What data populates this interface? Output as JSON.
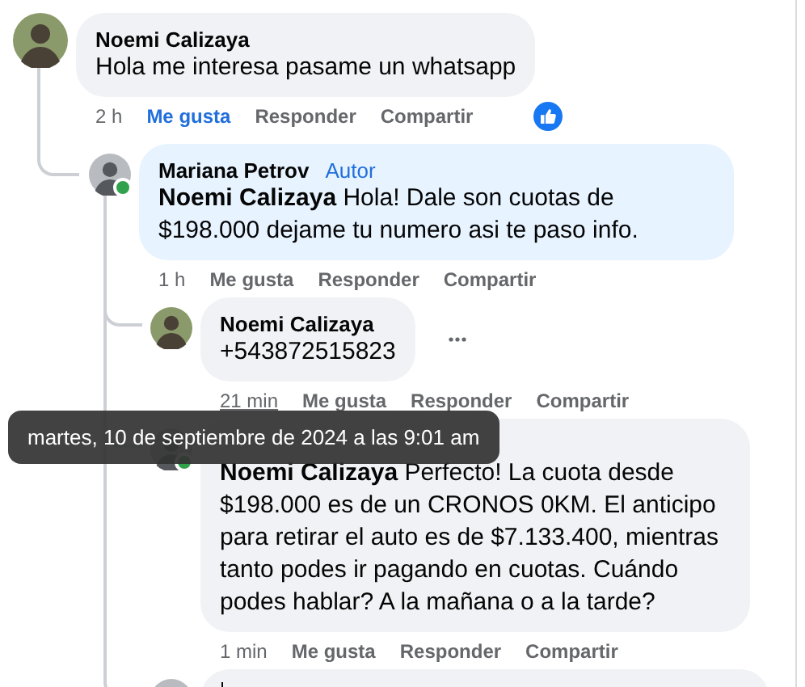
{
  "comments": [
    {
      "author": "Noemi Calizaya",
      "text": "Hola me interesa pasame un whatsapp",
      "time": "2 h",
      "time_hovered": false,
      "liked": true,
      "actions": [
        "Me gusta",
        "Responder",
        "Compartir"
      ],
      "has_reaction": true,
      "replies": [
        {
          "author": "Mariana Petrov",
          "badge": "Autor",
          "text": "**Noemi Calizaya** Hola! Dale son cuotas de $198.000 dejame tu numero asi te paso info.",
          "online": true,
          "time": "1 h",
          "time_hovered": false,
          "liked": false,
          "actions": [
            "Me gusta",
            "Responder",
            "Compartir"
          ],
          "replies": [
            {
              "author": "Noemi Calizaya",
              "text": "+543872515823",
              "show_menu": true,
              "time": "21 min",
              "time_hovered": true,
              "liked": false,
              "actions": [
                "Me gusta",
                "Responder",
                "Compartir"
              ]
            },
            {
              "is_author": true,
              "text": "**Noemi Calizaya** Perfecto! La cuota desde $198.000 es de un CRONOS 0KM. El anticipo para retirar el auto es de $7.133.400, mientras tanto podes ir pagando en cuotas. Cuándo podes hablar? A la mañana o a la tarde?",
              "online": true,
              "time": "1 min",
              "time_hovered": false,
              "liked": false,
              "actions": [
                "Me gusta",
                "Responder",
                "Compartir"
              ]
            }
          ],
          "reply_box": {
            "focused": true
          }
        }
      ]
    }
  ],
  "tooltip": {
    "text": "martes, 10 de septiembre de 2024 a las 9:01 am"
  }
}
